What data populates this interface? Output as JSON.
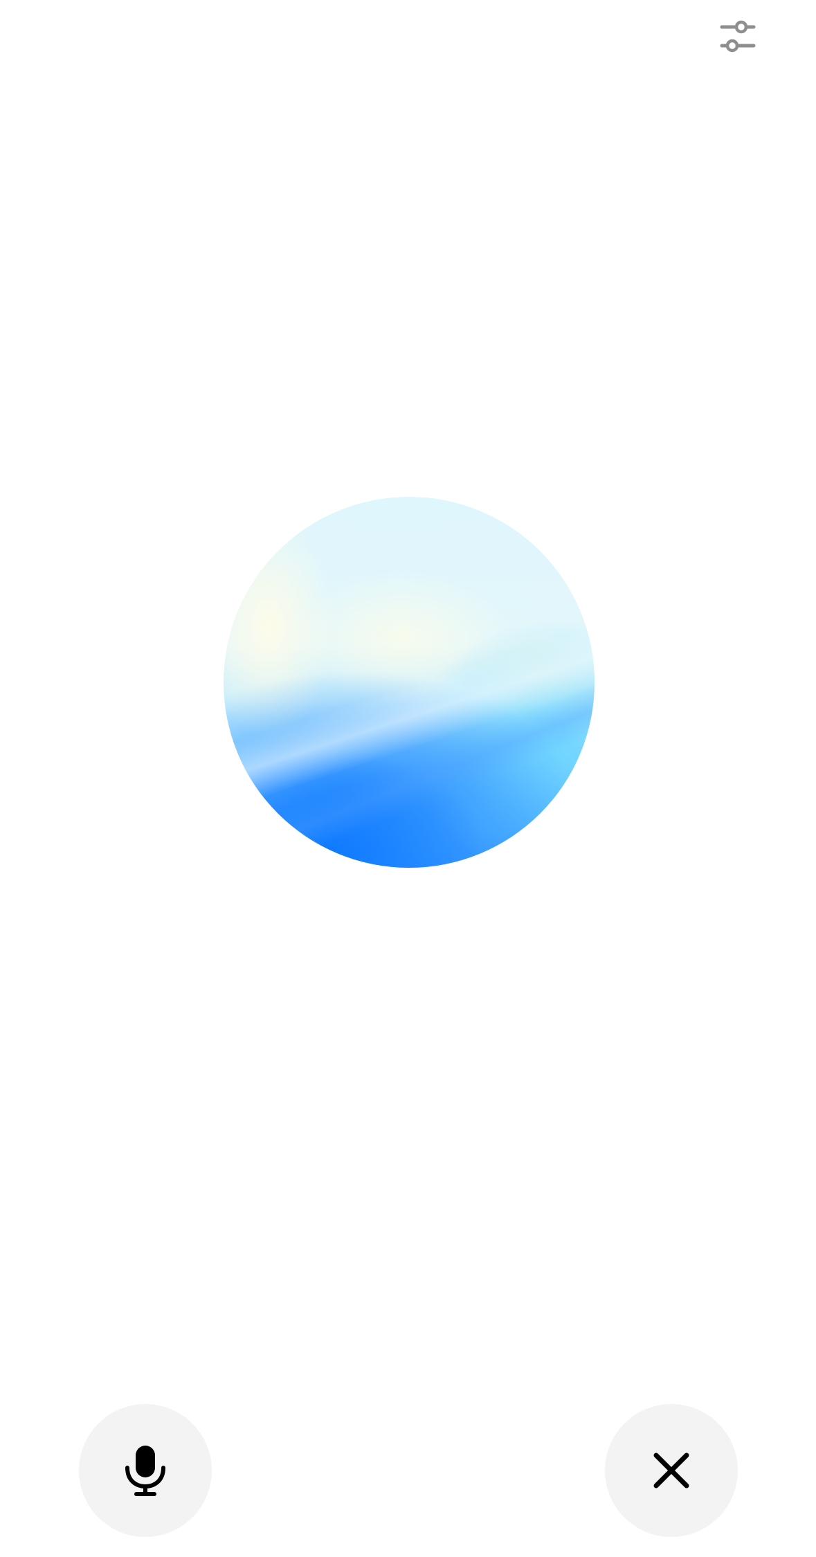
{
  "header": {
    "settings_icon": "sliders-icon"
  },
  "orb": {
    "colors": {
      "top": "#def6fc",
      "highlight": "#fcfbe9",
      "mid": "#8fd4ff",
      "bottom": "#0d78ff"
    }
  },
  "controls": {
    "mic_icon": "microphone-icon",
    "close_icon": "close-icon",
    "button_background": "#f3f3f3"
  }
}
